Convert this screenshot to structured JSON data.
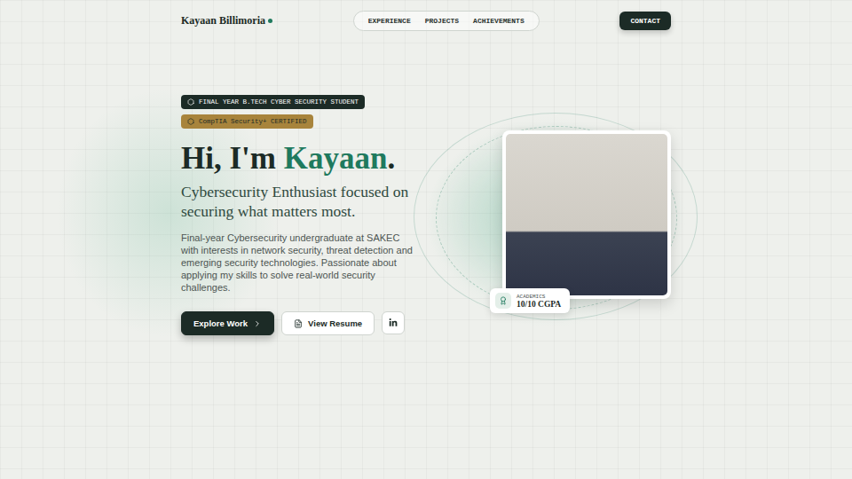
{
  "nav": {
    "logo": "Kayaan Billimoria",
    "links": [
      {
        "label": "EXPERIENCE"
      },
      {
        "label": "PROJECTS"
      },
      {
        "label": "ACHIEVEMENTS"
      }
    ],
    "cta": "CONTACT"
  },
  "hero": {
    "badges": [
      {
        "label": "FINAL YEAR B.TECH CYBER SECURITY STUDENT",
        "color": "#1c2b26"
      },
      {
        "label": "CompTIA Security+ CERTIFIED",
        "color": "#a8843c"
      }
    ],
    "greeting": "Hi, I'm ",
    "name": "Kayaan",
    "punct": ".",
    "subtitle": "Cybersecurity Enthusiast focused on securing what matters most.",
    "description": "Final-year Cybersecurity undergraduate at SAKEC with interests in network security, threat detection and emerging security technologies. Passionate about applying my skills to solve real-world security challenges.",
    "buttons": [
      {
        "label": "Explore Work",
        "kind": "primary"
      },
      {
        "label": "View Resume",
        "kind": "secondary"
      }
    ]
  },
  "photo_card": {
    "caption_label": "ACADEMICS",
    "caption_value": "10/10 CGPA"
  }
}
